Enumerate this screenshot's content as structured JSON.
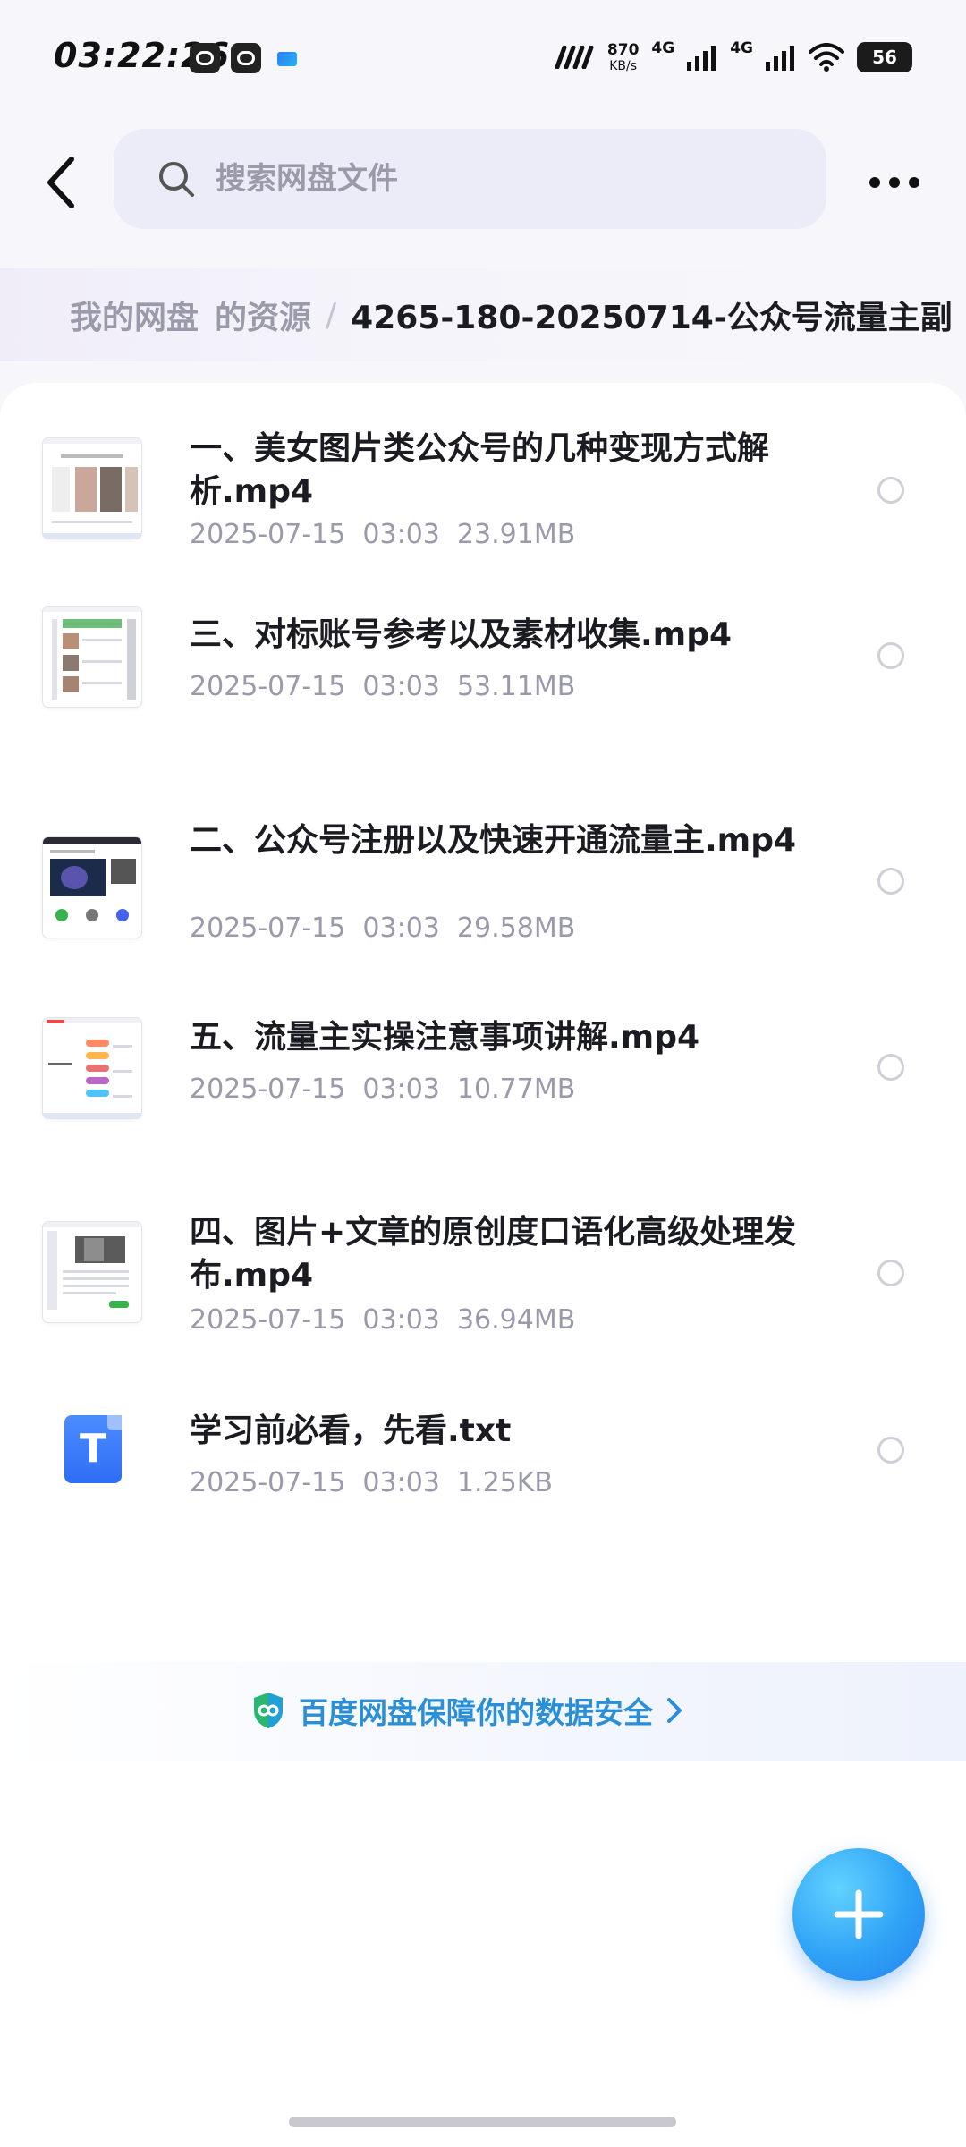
{
  "status_bar": {
    "time": "03:22:26",
    "net_speed_value": "870",
    "net_speed_unit": "KB/s",
    "signal1_label": "4G",
    "signal2_label": "4G",
    "battery": "56"
  },
  "header": {
    "search_placeholder": "搜索网盘文件"
  },
  "breadcrumb": {
    "items": [
      "我的网盘",
      "的资源"
    ],
    "current": "4265-180-20250714-公众号流量主副"
  },
  "files": [
    {
      "name": "一、美女图片类公众号的几种变现方式解析.mp4",
      "date": "2025-07-15  03:03",
      "size": "23.91MB",
      "icon": "video-thumbnail"
    },
    {
      "name": "三、对标账号参考以及素材收集.mp4",
      "date": "2025-07-15  03:03",
      "size": "53.11MB",
      "icon": "video-thumbnail"
    },
    {
      "name": "二、公众号注册以及快速开通流量主.mp4",
      "date": "2025-07-15  03:03",
      "size": "29.58MB",
      "icon": "video-thumbnail"
    },
    {
      "name": "五、流量主实操注意事项讲解.mp4",
      "date": "2025-07-15  03:03",
      "size": "10.77MB",
      "icon": "video-thumbnail"
    },
    {
      "name": "四、图片+文章的原创度口语化高级处理发布.mp4",
      "date": "2025-07-15  03:03",
      "size": "36.94MB",
      "icon": "video-thumbnail"
    },
    {
      "name": "学习前必看，先看.txt",
      "date": "2025-07-15  03:03",
      "size": "1.25KB",
      "icon": "txt-file-icon",
      "icon_letter": "T"
    }
  ],
  "security_banner": {
    "text": "百度网盘保障你的数据安全"
  },
  "colors": {
    "accent": "#2fa2f6",
    "security_text": "#2a8fd6",
    "muted_text": "#9a9aab"
  }
}
